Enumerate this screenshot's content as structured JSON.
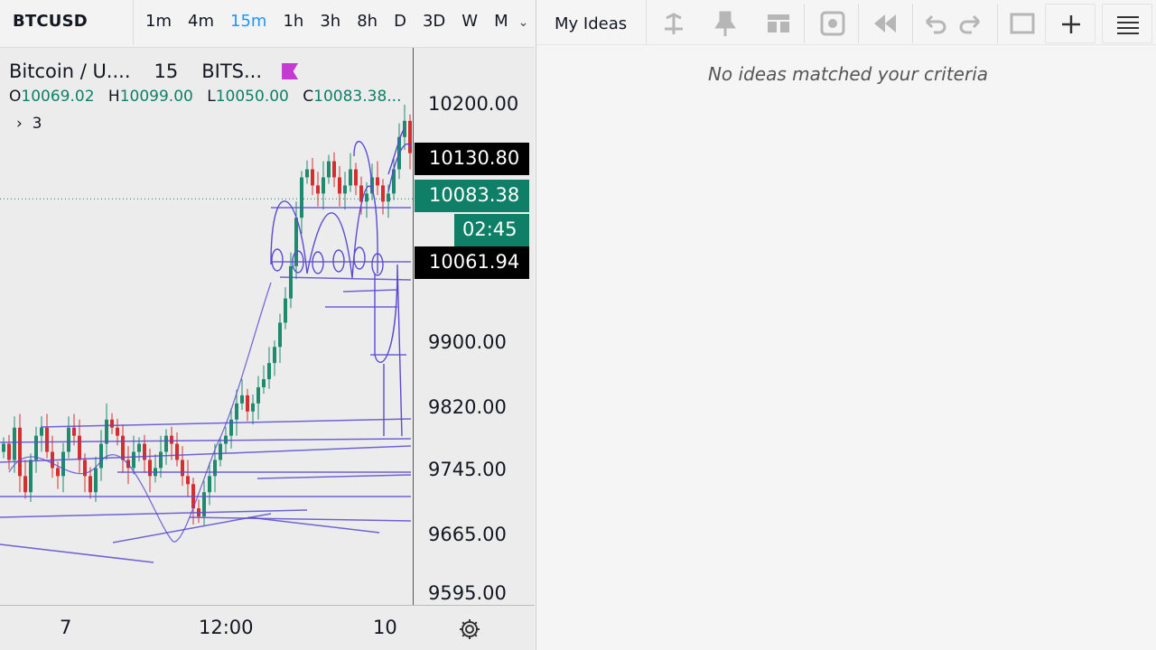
{
  "toolbar": {
    "symbol": "BTCUSD",
    "intervals": [
      "1m",
      "4m",
      "15m",
      "1h",
      "3h",
      "8h",
      "D",
      "3D",
      "W",
      "M"
    ],
    "active_interval": "15m"
  },
  "legend": {
    "title": "Bitcoin / U....",
    "interval": "15",
    "exchange": "BITS...",
    "open_label": "O",
    "open": "10069.02",
    "high_label": "H",
    "high": "10099.00",
    "low_label": "L",
    "low": "10050.00",
    "close_label": "C",
    "close": "10083.38...",
    "indicator_count": "3"
  },
  "price_axis": {
    "ticks": [
      "10200.00",
      "9900.00",
      "9820.00",
      "9745.00",
      "9665.00",
      "9595.00"
    ],
    "tag_high": "10130.80",
    "tag_last": "10083.38",
    "tag_timer": "02:45",
    "tag_low": "10061.94"
  },
  "time_axis": {
    "ticks": [
      "7",
      "12:00",
      "10"
    ]
  },
  "ideas": {
    "tab_label": "My Ideas",
    "empty_message": "No ideas matched your criteria"
  },
  "colors": {
    "up": "#1e8a6e",
    "down": "#d32f2f",
    "drawing": "#5b4bd1",
    "last_price": "#0f8067"
  },
  "chart_data": {
    "type": "candlestick",
    "symbol": "BTCUSD",
    "interval": "15",
    "ylim": [
      9560,
      10250
    ],
    "y_ticks": [
      10200,
      9900,
      9820,
      9745,
      9665,
      9595
    ],
    "x_ticks": [
      "7",
      "12:00",
      "10"
    ],
    "last_price": 10083.38,
    "marked_prices": [
      10130.8,
      10083.38,
      10061.94
    ],
    "candles_close_approx": [
      9780,
      9760,
      9800,
      9740,
      9720,
      9760,
      9790,
      9800,
      9770,
      9750,
      9740,
      9770,
      9800,
      9790,
      9760,
      9740,
      9720,
      9750,
      9780,
      9810,
      9800,
      9790,
      9760,
      9750,
      9770,
      9780,
      9760,
      9740,
      9750,
      9770,
      9790,
      9780,
      9760,
      9740,
      9730,
      9700,
      9690,
      9720,
      9740,
      9760,
      9780,
      9790,
      9810,
      9830,
      9840,
      9820,
      9830,
      9850,
      9860,
      9880,
      9900,
      9930,
      9960,
      10000,
      10060,
      10110,
      10120,
      10100,
      10090,
      10110,
      10130,
      10110,
      10090,
      10100,
      10120,
      10100,
      10080,
      10090,
      10110,
      10100,
      10080,
      10090,
      10120,
      10160,
      10180,
      10140,
      10100,
      10083
    ]
  }
}
